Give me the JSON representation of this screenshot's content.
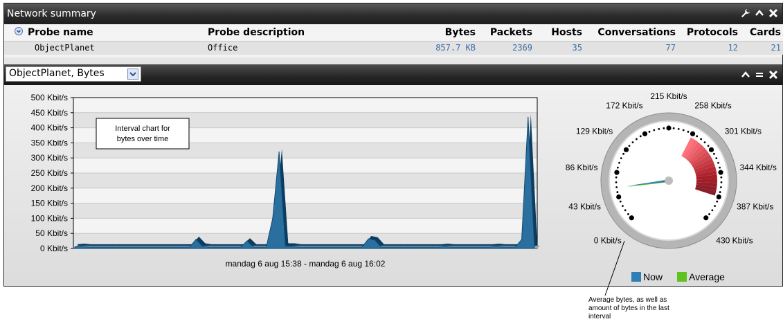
{
  "panel": {
    "title": "Network summary"
  },
  "table": {
    "columns": [
      "Probe name",
      "Probe description",
      "Bytes",
      "Packets",
      "Hosts",
      "Conversations",
      "Protocols",
      "Cards"
    ],
    "row": [
      "ObjectPlanet",
      "Office",
      "857.7 KB",
      "2369",
      "35",
      "77",
      "12",
      "21"
    ]
  },
  "chart_panel": {
    "selector_value": "ObjectPlanet, Bytes"
  },
  "chart_data": [
    {
      "type": "area",
      "title": "",
      "xlabel": "mandag 6 aug 15:38 - mandag 6 aug 16:02",
      "ylabel": "",
      "y_tick_labels": [
        "500 Kbit/s",
        "450 Kbit/s",
        "400 Kbit/s",
        "350 Kbit/s",
        "300 Kbit/s",
        "250 Kbit/s",
        "200 Kbit/s",
        "150 Kbit/s",
        "100 Kbit/s",
        "50 Kbit/s",
        "0 Kbit/s"
      ],
      "ylim": [
        0,
        500
      ],
      "grid": true,
      "annotation": "Interval chart for bytes over time",
      "x": [
        0,
        1,
        2,
        3,
        4,
        5,
        6,
        7,
        8,
        9,
        10,
        11,
        12,
        13,
        14,
        15,
        16,
        17,
        18,
        19,
        20,
        21,
        22,
        23,
        24,
        25,
        26,
        27,
        28,
        29,
        30,
        31,
        32,
        33,
        34,
        35,
        36,
        37,
        38,
        39,
        40,
        41,
        42,
        43,
        44,
        45,
        46,
        47,
        48,
        49,
        50,
        51,
        52,
        53,
        54,
        55,
        56,
        57,
        58,
        59,
        60,
        61,
        62,
        63,
        64,
        65,
        66,
        67,
        68,
        69,
        70,
        71,
        72
      ],
      "values": [
        5,
        7,
        5,
        5,
        5,
        5,
        5,
        5,
        5,
        5,
        5,
        5,
        5,
        5,
        5,
        5,
        5,
        5,
        5,
        30,
        8,
        5,
        5,
        5,
        5,
        5,
        5,
        25,
        5,
        5,
        5,
        100,
        320,
        8,
        8,
        5,
        5,
        5,
        5,
        5,
        5,
        5,
        5,
        5,
        5,
        5,
        32,
        28,
        5,
        5,
        5,
        5,
        5,
        5,
        5,
        5,
        5,
        5,
        7,
        5,
        5,
        5,
        5,
        5,
        5,
        5,
        7,
        5,
        5,
        5,
        30,
        435,
        5
      ]
    },
    {
      "type": "gauge",
      "tick_labels": [
        "0 Kbit/s",
        "43 Kbit/s",
        "86 Kbit/s",
        "129 Kbit/s",
        "172 Kbit/s",
        "215 Kbit/s",
        "258 Kbit/s",
        "301 Kbit/s",
        "344 Kbit/s",
        "387 Kbit/s",
        "430 Kbit/s"
      ],
      "range": [
        0,
        430
      ],
      "now_value": 60,
      "average_value": 58,
      "highlight_range": [
        258,
        387
      ],
      "legend": [
        "Now",
        "Average"
      ],
      "colors": {
        "now": "#2e7fb5",
        "average": "#5fc21f",
        "highlight": "#c41f24"
      },
      "annotation": "Average bytes, as well as amount of bytes in the last interval"
    }
  ]
}
